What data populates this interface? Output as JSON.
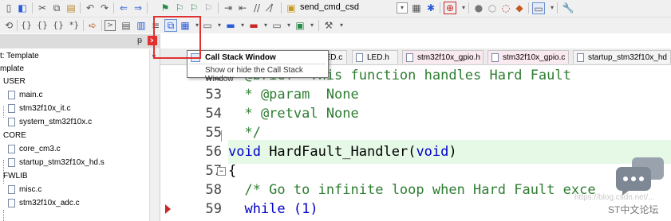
{
  "toolbar1": {
    "icons": [
      "open-icon",
      "save-all-icon",
      "cut-icon",
      "copy-icon",
      "paste-icon",
      "undo-icon",
      "redo-icon",
      "nav-back-icon",
      "nav-forward-icon",
      "bookmark-set-icon",
      "bookmark-prev-icon",
      "bookmark-next-icon",
      "bookmark-clear-icon",
      "indent-icon",
      "outdent-icon",
      "comment-icon",
      "uncomment-icon",
      "find-in-files-icon",
      "combo-dropdown-icon",
      "find-icon",
      "incremental-find-icon",
      "debug-icon",
      "breakpoint-icon",
      "disabled-breakpoint-icon",
      "kill-breakpoints-icon",
      "window-icon",
      "config-icon"
    ],
    "combo_label": "send_cmd_csd"
  },
  "toolbar2": {
    "icons": [
      "reset-icon",
      "step-into-icon",
      "step-over-icon",
      "step-out-icon",
      "run-to-cursor-icon",
      "show-next-statement-icon",
      "command-window-icon",
      "disassembly-window-icon",
      "symbols-window-icon",
      "registers-window-icon",
      "call-stack-window-icon",
      "watch-window-icon",
      "memory-window-icon",
      "serial-window-icon",
      "analysis-window-icon",
      "trace-window-icon",
      "system-viewer-icon",
      "toolbox-icon"
    ]
  },
  "project": {
    "pin_glyph": "ᵽ",
    "items": [
      {
        "label": "t: Template"
      },
      {
        "label": "mplate"
      },
      {
        "label": "USER"
      },
      {
        "label": "main.c"
      },
      {
        "label": "stm32f10x_it.c"
      },
      {
        "label": "system_stm32f10x.c"
      },
      {
        "label": "CORE"
      },
      {
        "label": "core_cm3.c"
      },
      {
        "label": "startup_stm32f10x_hd.s"
      },
      {
        "label": "FWLIB"
      },
      {
        "label": "misc.c"
      },
      {
        "label": "stm32f10x_adc.c"
      }
    ]
  },
  "tabs": [
    {
      "label": "LED.c"
    },
    {
      "label": "LED.h"
    },
    {
      "label": "stm32f10x_gpio.h"
    },
    {
      "label": "stm32f10x_gpio.c"
    },
    {
      "label": "startup_stm32f10x_hd"
    }
  ],
  "tooltip": {
    "title": "Call Stack Window",
    "description": "Show or hide the Call Stack Window"
  },
  "code": {
    "lines": [
      {
        "num": "52",
        "text": "  @brief  This function handles Hard Fault"
      },
      {
        "num": "53",
        "text": "  * @param  None"
      },
      {
        "num": "54",
        "text": "  * @retval None"
      },
      {
        "num": "55",
        "text": "  */"
      },
      {
        "num": "56",
        "kw1": "void",
        "ident": " HardFault_Handler",
        "paren": "(",
        "kw2": "void",
        "close": ")"
      },
      {
        "num": "57",
        "text": "{"
      },
      {
        "num": "58",
        "text": "  /* Go to infinite loop when Hard Fault exce"
      },
      {
        "num": "59",
        "text": "  while (1)"
      }
    ]
  },
  "watermark": "https://blog.csdn.net/...",
  "brand": "ST中文论坛",
  "colors": {
    "comment": "#2e7d32",
    "keyword": "#0000c8",
    "highlight_line": "#e6f9e6",
    "annotation_box": "#e03030"
  }
}
